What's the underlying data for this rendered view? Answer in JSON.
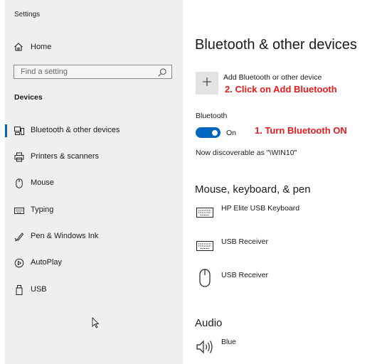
{
  "app": {
    "title": "Settings"
  },
  "sidebar": {
    "home_label": "Home",
    "search_placeholder": "Find a setting",
    "section_title": "Devices",
    "items": [
      {
        "label": "Bluetooth & other devices",
        "icon": "bluetooth-devices-icon",
        "active": true
      },
      {
        "label": "Printers & scanners",
        "icon": "printer-icon"
      },
      {
        "label": "Mouse",
        "icon": "mouse-icon"
      },
      {
        "label": "Typing",
        "icon": "keyboard-icon"
      },
      {
        "label": "Pen & Windows Ink",
        "icon": "pen-icon"
      },
      {
        "label": "AutoPlay",
        "icon": "autoplay-icon"
      },
      {
        "label": "USB",
        "icon": "usb-icon"
      }
    ]
  },
  "main": {
    "title": "Bluetooth & other devices",
    "add_device_label": "Add Bluetooth or other device",
    "bluetooth_label": "Bluetooth",
    "bluetooth_on": true,
    "toggle_state": "On",
    "discoverable_text": "Now discoverable as \"\\WIN10\"",
    "mouse_keyboard_pen": {
      "title": "Mouse, keyboard, & pen",
      "devices": [
        {
          "name": "HP Elite USB Keyboard",
          "icon": "keyboard-icon"
        },
        {
          "name": "USB Receiver",
          "icon": "keyboard-icon"
        },
        {
          "name": "USB Receiver",
          "icon": "mouse-icon"
        }
      ]
    },
    "audio": {
      "title": "Audio",
      "devices": [
        {
          "name": "Blue",
          "icon": "speaker-icon"
        }
      ]
    }
  },
  "annotations": {
    "step1": "1. Turn Bluetooth ON",
    "step2": "2. Click on Add Bluetooth"
  },
  "colors": {
    "accent": "#0067c0",
    "annotation": "#e8191d",
    "sidebar_bg": "#efefef"
  }
}
